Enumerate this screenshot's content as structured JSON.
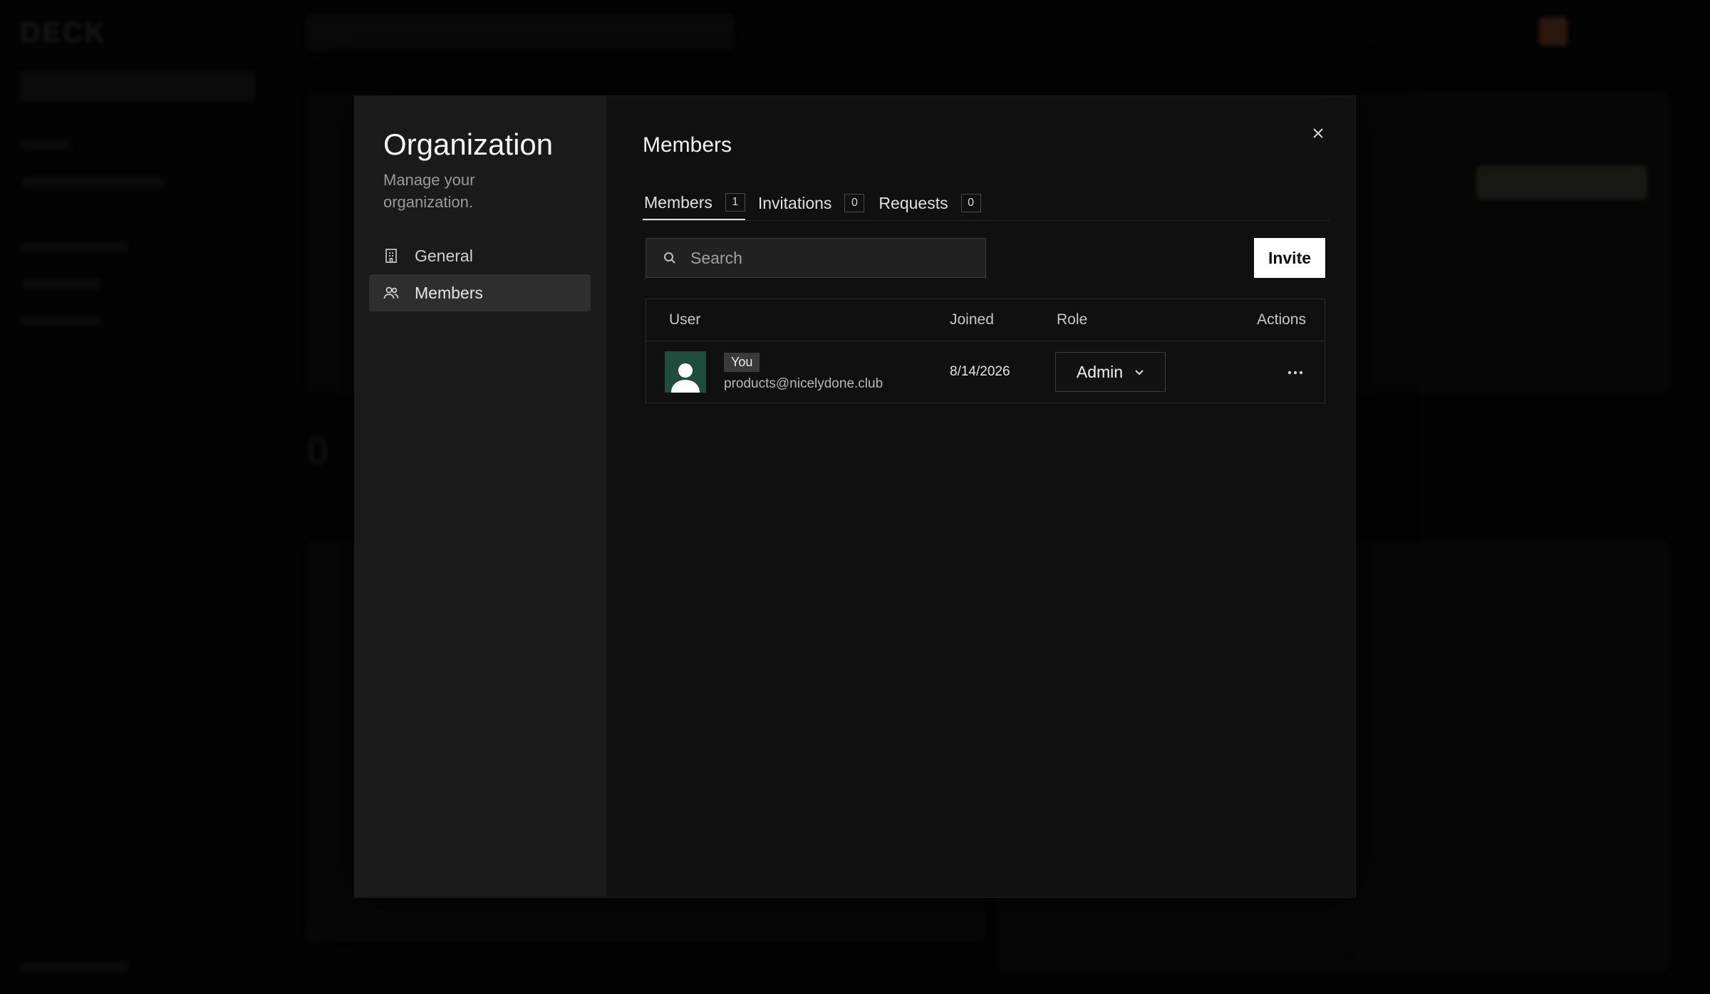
{
  "background_app": {
    "logo": "DECK",
    "stat": "0"
  },
  "sidebar": {
    "title": "Organization",
    "subtitle": "Manage your organization.",
    "items": [
      {
        "label": "General",
        "icon": "building-icon",
        "active": false
      },
      {
        "label": "Members",
        "icon": "users-icon",
        "active": true
      }
    ]
  },
  "main": {
    "title": "Members",
    "tabs": [
      {
        "label": "Members",
        "count": "1",
        "active": true
      },
      {
        "label": "Invitations",
        "count": "0",
        "active": false
      },
      {
        "label": "Requests",
        "count": "0",
        "active": false
      }
    ],
    "search": {
      "placeholder": "Search",
      "value": ""
    },
    "invite_label": "Invite",
    "table": {
      "headers": {
        "user": "User",
        "joined": "Joined",
        "role": "Role",
        "actions": "Actions"
      },
      "rows": [
        {
          "badge": "You",
          "email": "products@nicelydone.club",
          "joined": "8/14/2026",
          "role": "Admin"
        }
      ]
    }
  },
  "colors": {
    "avatar_bg": "#1f4d3d",
    "invite_bg": "#ffffff"
  }
}
